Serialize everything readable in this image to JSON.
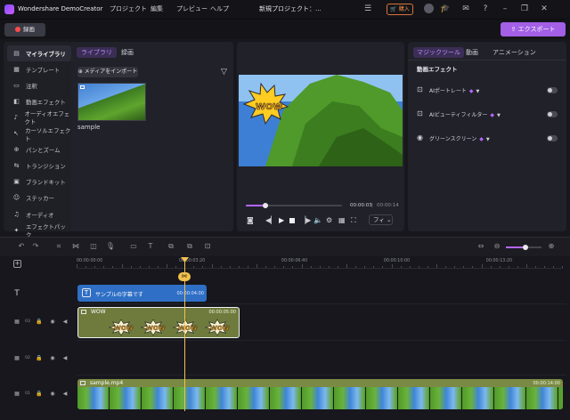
{
  "app": {
    "title": "Wondershare DemoCreator",
    "project_title": "新規プロジェクト：...",
    "menus": [
      "プロジェクト",
      "編集",
      "プレビュー",
      "ヘルプ"
    ],
    "buy_label": "購入"
  },
  "record_label": "録画",
  "export_label": "エクスポート",
  "library": {
    "tabs": [
      "ライブラリ",
      "録画"
    ],
    "import_label": "メディアをインポート",
    "media_name": "sample"
  },
  "sidebar": {
    "items": [
      {
        "label": "マイライブラリ",
        "icon": "library-icon"
      },
      {
        "label": "テンプレート",
        "icon": "template-icon"
      },
      {
        "label": "注釈",
        "icon": "annotation-icon"
      },
      {
        "label": "動画エフェクト",
        "icon": "video-effect-icon"
      },
      {
        "label": "オーディオエフェクト",
        "icon": "audio-effect-icon"
      },
      {
        "label": "カーソルエフェクト",
        "icon": "cursor-icon"
      },
      {
        "label": "パンとズーム",
        "icon": "pan-zoom-icon"
      },
      {
        "label": "トランジション",
        "icon": "transition-icon"
      },
      {
        "label": "ブランドキット",
        "icon": "brand-kit-icon"
      },
      {
        "label": "ステッカー",
        "icon": "sticker-icon"
      },
      {
        "label": "オーディオ",
        "icon": "audio-icon"
      },
      {
        "label": "エフェクトパック",
        "icon": "effect-pack-icon"
      }
    ]
  },
  "preview": {
    "current_time": "00:00:03",
    "total_time": "00:00:14",
    "fit_label": "フィ",
    "progress": 0.2
  },
  "right_panel": {
    "tabs": [
      "マジックツール",
      "動画",
      "アニメーション"
    ],
    "section_title": "動画エフェクト",
    "features": [
      {
        "label": "AIポートレート"
      },
      {
        "label": "AIビューティフィルター"
      },
      {
        "label": "グリーンスクリーン"
      }
    ]
  },
  "timeline": {
    "ruler": [
      "00:00:00:00",
      "00:00:03:20",
      "00:00:06:40",
      "00:00:10:00",
      "00:00:13:20"
    ],
    "text_clip": {
      "label": "サンプルの字幕です",
      "duration": "00:00:04:00"
    },
    "sticker_clip": {
      "label": "WOW",
      "duration": "00:00:05:00"
    },
    "video_clip": {
      "label": "sample.mp4",
      "duration": "00:00:14:00"
    },
    "track_numbers": [
      "03",
      "02",
      "01"
    ],
    "playhead_time": "00:00:03:20",
    "zoom_level": 0.55
  },
  "colors": {
    "accent": "#b566ff",
    "export": "#a35fe6",
    "record_dot": "#ff4b4b",
    "playhead": "#f2c14e",
    "text_clip": "#2f6fc5",
    "sticker_clip": "#6e7b3c",
    "video_clip": "#7a8a44"
  }
}
